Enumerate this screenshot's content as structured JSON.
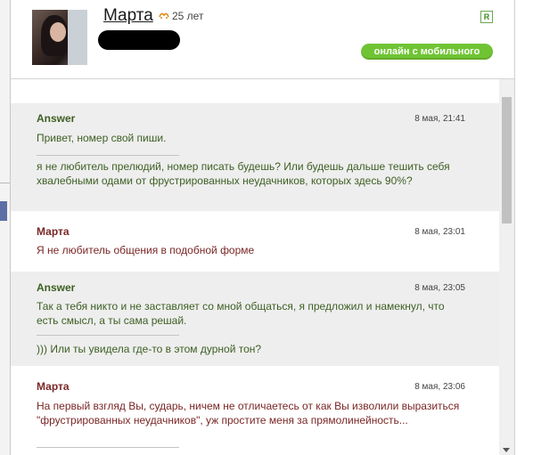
{
  "header": {
    "username": "Марта",
    "age": "25 лет",
    "badge_r": "R",
    "mobile_status": "онлайн с мобильного",
    "icons": [
      "zodiac-icon",
      "avatar"
    ]
  },
  "messages": [
    {
      "sender": "Answer",
      "time": "8 мая, 21:41",
      "parts": [
        "Привет, номер свой пиши.",
        "я не любитель прелюдий, номер писать будешь? Или будешь дальше тешить себя хвалебными одами от фрустрированных неудачников, которых здесь 90%?"
      ]
    },
    {
      "sender": "Марта",
      "time": "8 мая, 23:01",
      "parts": [
        "Я не любитель общения в подобной форме"
      ]
    },
    {
      "sender": "Answer",
      "time": "8 мая, 23:05",
      "parts": [
        "Так а тебя никто и не заставляет со мной общаться, я предложил и намекнул, что есть смысл, а ты сама решай.",
        "))) Или ты увидела где-то в этом дурной тон?"
      ]
    },
    {
      "sender": "Марта",
      "time": "8 мая, 23:06",
      "parts": [
        "На первый взгляд Вы, сударь, ничем не отличаетесь от как Вы изволили выразиться \"фрустрированных неудачников\", уж простите меня за прямолинейность..."
      ]
    }
  ],
  "colors": {
    "answer": "#3d5f23",
    "marta": "#7a2626",
    "mobile_badge": "#70c434",
    "gray_bg": "#eeeeee"
  }
}
